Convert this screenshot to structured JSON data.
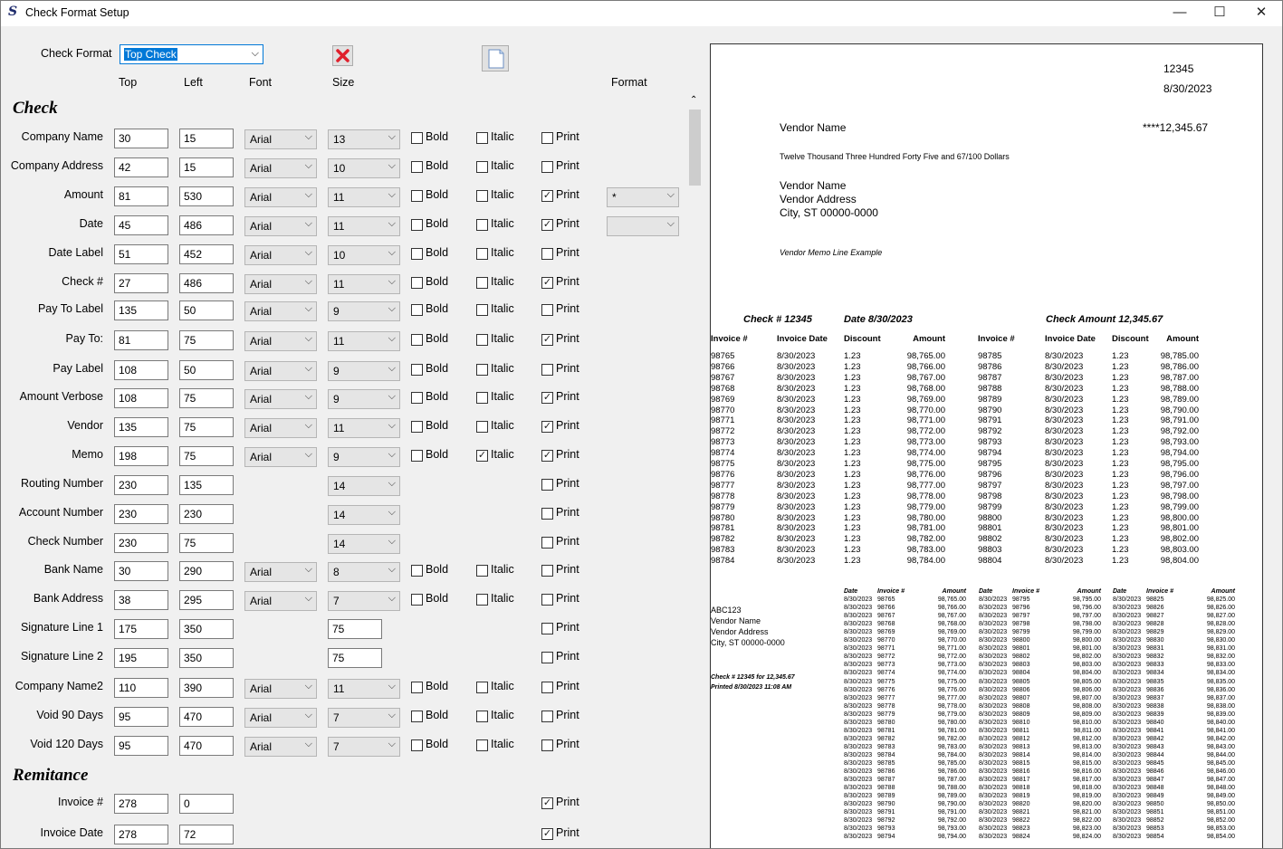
{
  "window": {
    "title": "Check Format Setup",
    "icon": "app-s-icon",
    "minimize": "—",
    "maximize": "☐",
    "close": "✕"
  },
  "format": {
    "label": "Check Format",
    "value": "Top Check",
    "delete_icon": "delete-icon",
    "page_icon": "page-icon"
  },
  "headers": {
    "top": "Top",
    "left": "Left",
    "font": "Font",
    "size": "Size",
    "format": "Format"
  },
  "sections": {
    "check": "Check",
    "remittance": "Remitance"
  },
  "labels": {
    "bold": "Bold",
    "italic": "Italic",
    "print": "Print"
  },
  "rows": [
    {
      "label": "Company Name",
      "top": "30",
      "left": "15",
      "font": "Arial",
      "size": "13",
      "bold": false,
      "italic": false,
      "print": false
    },
    {
      "label": "Company Address",
      "top": "42",
      "left": "15",
      "font": "Arial",
      "size": "10",
      "bold": false,
      "italic": false,
      "print": false
    },
    {
      "label": "Amount",
      "top": "81",
      "left": "530",
      "font": "Arial",
      "size": "11",
      "bold": false,
      "italic": false,
      "print": true,
      "format": "*"
    },
    {
      "label": "Date",
      "top": "45",
      "left": "486",
      "font": "Arial",
      "size": "11",
      "bold": false,
      "italic": false,
      "print": true,
      "format": ""
    },
    {
      "label": "Date Label",
      "top": "51",
      "left": "452",
      "font": "Arial",
      "size": "10",
      "bold": false,
      "italic": false,
      "print": false
    },
    {
      "label": "Check #",
      "top": "27",
      "left": "486",
      "font": "Arial",
      "size": "11",
      "bold": false,
      "italic": false,
      "print": true
    },
    {
      "label": "Pay To Label",
      "top": "135",
      "left": "50",
      "font": "Arial",
      "size": "9",
      "bold": false,
      "italic": false,
      "print": false
    },
    {
      "label": "Pay To:",
      "top": "81",
      "left": "75",
      "font": "Arial",
      "size": "11",
      "bold": false,
      "italic": false,
      "print": true
    },
    {
      "label": "Pay Label",
      "top": "108",
      "left": "50",
      "font": "Arial",
      "size": "9",
      "bold": false,
      "italic": false,
      "print": false
    },
    {
      "label": "Amount Verbose",
      "top": "108",
      "left": "75",
      "font": "Arial",
      "size": "9",
      "bold": false,
      "italic": false,
      "print": true
    },
    {
      "label": "Vendor",
      "top": "135",
      "left": "75",
      "font": "Arial",
      "size": "11",
      "bold": false,
      "italic": false,
      "print": true
    },
    {
      "label": "Memo",
      "top": "198",
      "left": "75",
      "font": "Arial",
      "size": "9",
      "bold": false,
      "italic": true,
      "print": true
    },
    {
      "label": "Routing Number",
      "top": "230",
      "left": "135",
      "size": "14",
      "print": false
    },
    {
      "label": "Account Number",
      "top": "230",
      "left": "230",
      "size": "14",
      "print": false
    },
    {
      "label": "Check Number",
      "top": "230",
      "left": "75",
      "size": "14",
      "print": false
    },
    {
      "label": "Bank Name",
      "top": "30",
      "left": "290",
      "font": "Arial",
      "size": "8",
      "bold": false,
      "italic": false,
      "print": false
    },
    {
      "label": "Bank Address",
      "top": "38",
      "left": "295",
      "font": "Arial",
      "size": "7",
      "bold": false,
      "italic": false,
      "print": false
    },
    {
      "label": "Signature Line 1",
      "top": "175",
      "left": "350",
      "size_text": "75",
      "print": false
    },
    {
      "label": "Signature Line 2",
      "top": "195",
      "left": "350",
      "size_text": "75",
      "print": false
    },
    {
      "label": "Company Name2",
      "top": "110",
      "left": "390",
      "font": "Arial",
      "size": "11",
      "bold": false,
      "italic": false,
      "print": false
    },
    {
      "label": "Void 90 Days",
      "top": "95",
      "left": "470",
      "font": "Arial",
      "size": "7",
      "bold": false,
      "italic": false,
      "print": false
    },
    {
      "label": "Void 120 Days",
      "top": "95",
      "left": "470",
      "font": "Arial",
      "size": "7",
      "bold": false,
      "italic": false,
      "print": false
    }
  ],
  "remit_rows": [
    {
      "label": "Invoice #",
      "top": "278",
      "left": "0",
      "print": true
    },
    {
      "label": "Invoice Date",
      "top": "278",
      "left": "72",
      "print": true
    }
  ],
  "preview": {
    "check_number": "12345",
    "date": "8/30/2023",
    "vendor_label": "Vendor Name",
    "amount": "****12,345.67",
    "amount_verbose": "Twelve Thousand Three Hundred Forty Five  and 67/100 Dollars",
    "address": [
      "Vendor Name",
      "Vendor Address",
      "City, ST 00000-0000"
    ],
    "memo": "Vendor Memo Line Example",
    "stub_check": "Check # 12345",
    "stub_date": "Date 8/30/2023",
    "stub_amount": "Check Amount 12,345.67",
    "cols": [
      "Invoice #",
      "Invoice Date",
      "Discount",
      "Amount",
      "Invoice #",
      "Invoice Date",
      "Discount",
      "Amount"
    ],
    "stub_rows": [
      [
        "98765",
        "8/30/2023",
        "1.23",
        "98,765.00",
        "98785",
        "8/30/2023",
        "1.23",
        "98,785.00"
      ],
      [
        "98766",
        "8/30/2023",
        "1.23",
        "98,766.00",
        "98786",
        "8/30/2023",
        "1.23",
        "98,786.00"
      ],
      [
        "98767",
        "8/30/2023",
        "1.23",
        "98,767.00",
        "98787",
        "8/30/2023",
        "1.23",
        "98,787.00"
      ],
      [
        "98768",
        "8/30/2023",
        "1.23",
        "98,768.00",
        "98788",
        "8/30/2023",
        "1.23",
        "98,788.00"
      ],
      [
        "98769",
        "8/30/2023",
        "1.23",
        "98,769.00",
        "98789",
        "8/30/2023",
        "1.23",
        "98,789.00"
      ],
      [
        "98770",
        "8/30/2023",
        "1.23",
        "98,770.00",
        "98790",
        "8/30/2023",
        "1.23",
        "98,790.00"
      ],
      [
        "98771",
        "8/30/2023",
        "1.23",
        "98,771.00",
        "98791",
        "8/30/2023",
        "1.23",
        "98,791.00"
      ],
      [
        "98772",
        "8/30/2023",
        "1.23",
        "98,772.00",
        "98792",
        "8/30/2023",
        "1.23",
        "98,792.00"
      ],
      [
        "98773",
        "8/30/2023",
        "1.23",
        "98,773.00",
        "98793",
        "8/30/2023",
        "1.23",
        "98,793.00"
      ],
      [
        "98774",
        "8/30/2023",
        "1.23",
        "98,774.00",
        "98794",
        "8/30/2023",
        "1.23",
        "98,794.00"
      ],
      [
        "98775",
        "8/30/2023",
        "1.23",
        "98,775.00",
        "98795",
        "8/30/2023",
        "1.23",
        "98,795.00"
      ],
      [
        "98776",
        "8/30/2023",
        "1.23",
        "98,776.00",
        "98796",
        "8/30/2023",
        "1.23",
        "98,796.00"
      ],
      [
        "98777",
        "8/30/2023",
        "1.23",
        "98,777.00",
        "98797",
        "8/30/2023",
        "1.23",
        "98,797.00"
      ],
      [
        "98778",
        "8/30/2023",
        "1.23",
        "98,778.00",
        "98798",
        "8/30/2023",
        "1.23",
        "98,798.00"
      ],
      [
        "98779",
        "8/30/2023",
        "1.23",
        "98,779.00",
        "98799",
        "8/30/2023",
        "1.23",
        "98,799.00"
      ],
      [
        "98780",
        "8/30/2023",
        "1.23",
        "98,780.00",
        "98800",
        "8/30/2023",
        "1.23",
        "98,800.00"
      ],
      [
        "98781",
        "8/30/2023",
        "1.23",
        "98,781.00",
        "98801",
        "8/30/2023",
        "1.23",
        "98,801.00"
      ],
      [
        "98782",
        "8/30/2023",
        "1.23",
        "98,782.00",
        "98802",
        "8/30/2023",
        "1.23",
        "98,802.00"
      ],
      [
        "98783",
        "8/30/2023",
        "1.23",
        "98,783.00",
        "98803",
        "8/30/2023",
        "1.23",
        "98,803.00"
      ],
      [
        "98784",
        "8/30/2023",
        "1.23",
        "98,784.00",
        "98804",
        "8/30/2023",
        "1.23",
        "98,804.00"
      ]
    ],
    "remit_left": [
      "ABC123",
      "Vendor Name",
      "Vendor Address",
      "City, ST 00000-0000"
    ],
    "remit_check": "Check # 12345 for 12,345.67",
    "remit_printed": "Printed 8/30/2023 11:08 AM",
    "remit_cols": [
      "Date",
      "Invoice #",
      "Amount"
    ],
    "remit_rows": [
      [
        "8/30/2023",
        "98765",
        "98,765.00",
        "8/30/2023",
        "98795",
        "98,795.00",
        "8/30/2023",
        "98825",
        "98,825.00"
      ],
      [
        "8/30/2023",
        "98766",
        "98,766.00",
        "8/30/2023",
        "98796",
        "98,796.00",
        "8/30/2023",
        "98826",
        "98,826.00"
      ],
      [
        "8/30/2023",
        "98767",
        "98,767.00",
        "8/30/2023",
        "98797",
        "98,797.00",
        "8/30/2023",
        "98827",
        "98,827.00"
      ],
      [
        "8/30/2023",
        "98768",
        "98,768.00",
        "8/30/2023",
        "98798",
        "98,798.00",
        "8/30/2023",
        "98828",
        "98,828.00"
      ],
      [
        "8/30/2023",
        "98769",
        "98,769.00",
        "8/30/2023",
        "98799",
        "98,799.00",
        "8/30/2023",
        "98829",
        "98,829.00"
      ],
      [
        "8/30/2023",
        "98770",
        "98,770.00",
        "8/30/2023",
        "98800",
        "98,800.00",
        "8/30/2023",
        "98830",
        "98,830.00"
      ],
      [
        "8/30/2023",
        "98771",
        "98,771.00",
        "8/30/2023",
        "98801",
        "98,801.00",
        "8/30/2023",
        "98831",
        "98,831.00"
      ],
      [
        "8/30/2023",
        "98772",
        "98,772.00",
        "8/30/2023",
        "98802",
        "98,802.00",
        "8/30/2023",
        "98832",
        "98,832.00"
      ],
      [
        "8/30/2023",
        "98773",
        "98,773.00",
        "8/30/2023",
        "98803",
        "98,803.00",
        "8/30/2023",
        "98833",
        "98,833.00"
      ],
      [
        "8/30/2023",
        "98774",
        "98,774.00",
        "8/30/2023",
        "98804",
        "98,804.00",
        "8/30/2023",
        "98834",
        "98,834.00"
      ],
      [
        "8/30/2023",
        "98775",
        "98,775.00",
        "8/30/2023",
        "98805",
        "98,805.00",
        "8/30/2023",
        "98835",
        "98,835.00"
      ],
      [
        "8/30/2023",
        "98776",
        "98,776.00",
        "8/30/2023",
        "98806",
        "98,806.00",
        "8/30/2023",
        "98836",
        "98,836.00"
      ],
      [
        "8/30/2023",
        "98777",
        "98,777.00",
        "8/30/2023",
        "98807",
        "98,807.00",
        "8/30/2023",
        "98837",
        "98,837.00"
      ],
      [
        "8/30/2023",
        "98778",
        "98,778.00",
        "8/30/2023",
        "98808",
        "98,808.00",
        "8/30/2023",
        "98838",
        "98,838.00"
      ],
      [
        "8/30/2023",
        "98779",
        "98,779.00",
        "8/30/2023",
        "98809",
        "98,809.00",
        "8/30/2023",
        "98839",
        "98,839.00"
      ],
      [
        "8/30/2023",
        "98780",
        "98,780.00",
        "8/30/2023",
        "98810",
        "98,810.00",
        "8/30/2023",
        "98840",
        "98,840.00"
      ],
      [
        "8/30/2023",
        "98781",
        "98,781.00",
        "8/30/2023",
        "98811",
        "98,811.00",
        "8/30/2023",
        "98841",
        "98,841.00"
      ],
      [
        "8/30/2023",
        "98782",
        "98,782.00",
        "8/30/2023",
        "98812",
        "98,812.00",
        "8/30/2023",
        "98842",
        "98,842.00"
      ],
      [
        "8/30/2023",
        "98783",
        "98,783.00",
        "8/30/2023",
        "98813",
        "98,813.00",
        "8/30/2023",
        "98843",
        "98,843.00"
      ],
      [
        "8/30/2023",
        "98784",
        "98,784.00",
        "8/30/2023",
        "98814",
        "98,814.00",
        "8/30/2023",
        "98844",
        "98,844.00"
      ],
      [
        "8/30/2023",
        "98785",
        "98,785.00",
        "8/30/2023",
        "98815",
        "98,815.00",
        "8/30/2023",
        "98845",
        "98,845.00"
      ],
      [
        "8/30/2023",
        "98786",
        "98,786.00",
        "8/30/2023",
        "98816",
        "98,816.00",
        "8/30/2023",
        "98846",
        "98,846.00"
      ],
      [
        "8/30/2023",
        "98787",
        "98,787.00",
        "8/30/2023",
        "98817",
        "98,817.00",
        "8/30/2023",
        "98847",
        "98,847.00"
      ],
      [
        "8/30/2023",
        "98788",
        "98,788.00",
        "8/30/2023",
        "98818",
        "98,818.00",
        "8/30/2023",
        "98848",
        "98,848.00"
      ],
      [
        "8/30/2023",
        "98789",
        "98,789.00",
        "8/30/2023",
        "98819",
        "98,819.00",
        "8/30/2023",
        "98849",
        "98,849.00"
      ],
      [
        "8/30/2023",
        "98790",
        "98,790.00",
        "8/30/2023",
        "98820",
        "98,820.00",
        "8/30/2023",
        "98850",
        "98,850.00"
      ],
      [
        "8/30/2023",
        "98791",
        "98,791.00",
        "8/30/2023",
        "98821",
        "98,821.00",
        "8/30/2023",
        "98851",
        "98,851.00"
      ],
      [
        "8/30/2023",
        "98792",
        "98,792.00",
        "8/30/2023",
        "98822",
        "98,822.00",
        "8/30/2023",
        "98852",
        "98,852.00"
      ],
      [
        "8/30/2023",
        "98793",
        "98,793.00",
        "8/30/2023",
        "98823",
        "98,823.00",
        "8/30/2023",
        "98853",
        "98,853.00"
      ],
      [
        "8/30/2023",
        "98794",
        "98,794.00",
        "8/30/2023",
        "98824",
        "98,824.00",
        "8/30/2023",
        "98854",
        "98,854.00"
      ]
    ]
  }
}
